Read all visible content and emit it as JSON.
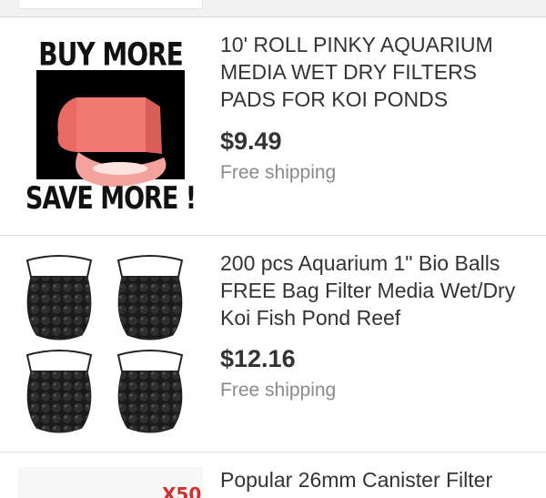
{
  "listings": [
    {
      "image": {
        "alt": "pink filter media roll",
        "top_caption": "BUY MORE",
        "bottom_caption": "SAVE MORE !"
      },
      "title": "10' ROLL PINKY AQUARIUM MEDIA WET DRY FILTERS PADS FOR KOI PONDS",
      "price": "$9.49",
      "shipping": "Free shipping"
    },
    {
      "image": {
        "alt": "four mesh bags of black bio balls"
      },
      "title": "200 pcs Aquarium 1\" Bio Balls FREE Bag Filter Media Wet/Dry Koi Fish Pond Reef",
      "price": "$12.16",
      "shipping": "Free shipping"
    },
    {
      "image": {
        "alt": "canister filter product image",
        "badge": "X50"
      },
      "title": "Popular 26mm Canister Filter"
    }
  ],
  "colors": {
    "text": "#333333",
    "muted": "#8a8a8a",
    "divider": "#dcdcdc",
    "badge": "#d32f2f",
    "media_pink": "#f07a72"
  }
}
